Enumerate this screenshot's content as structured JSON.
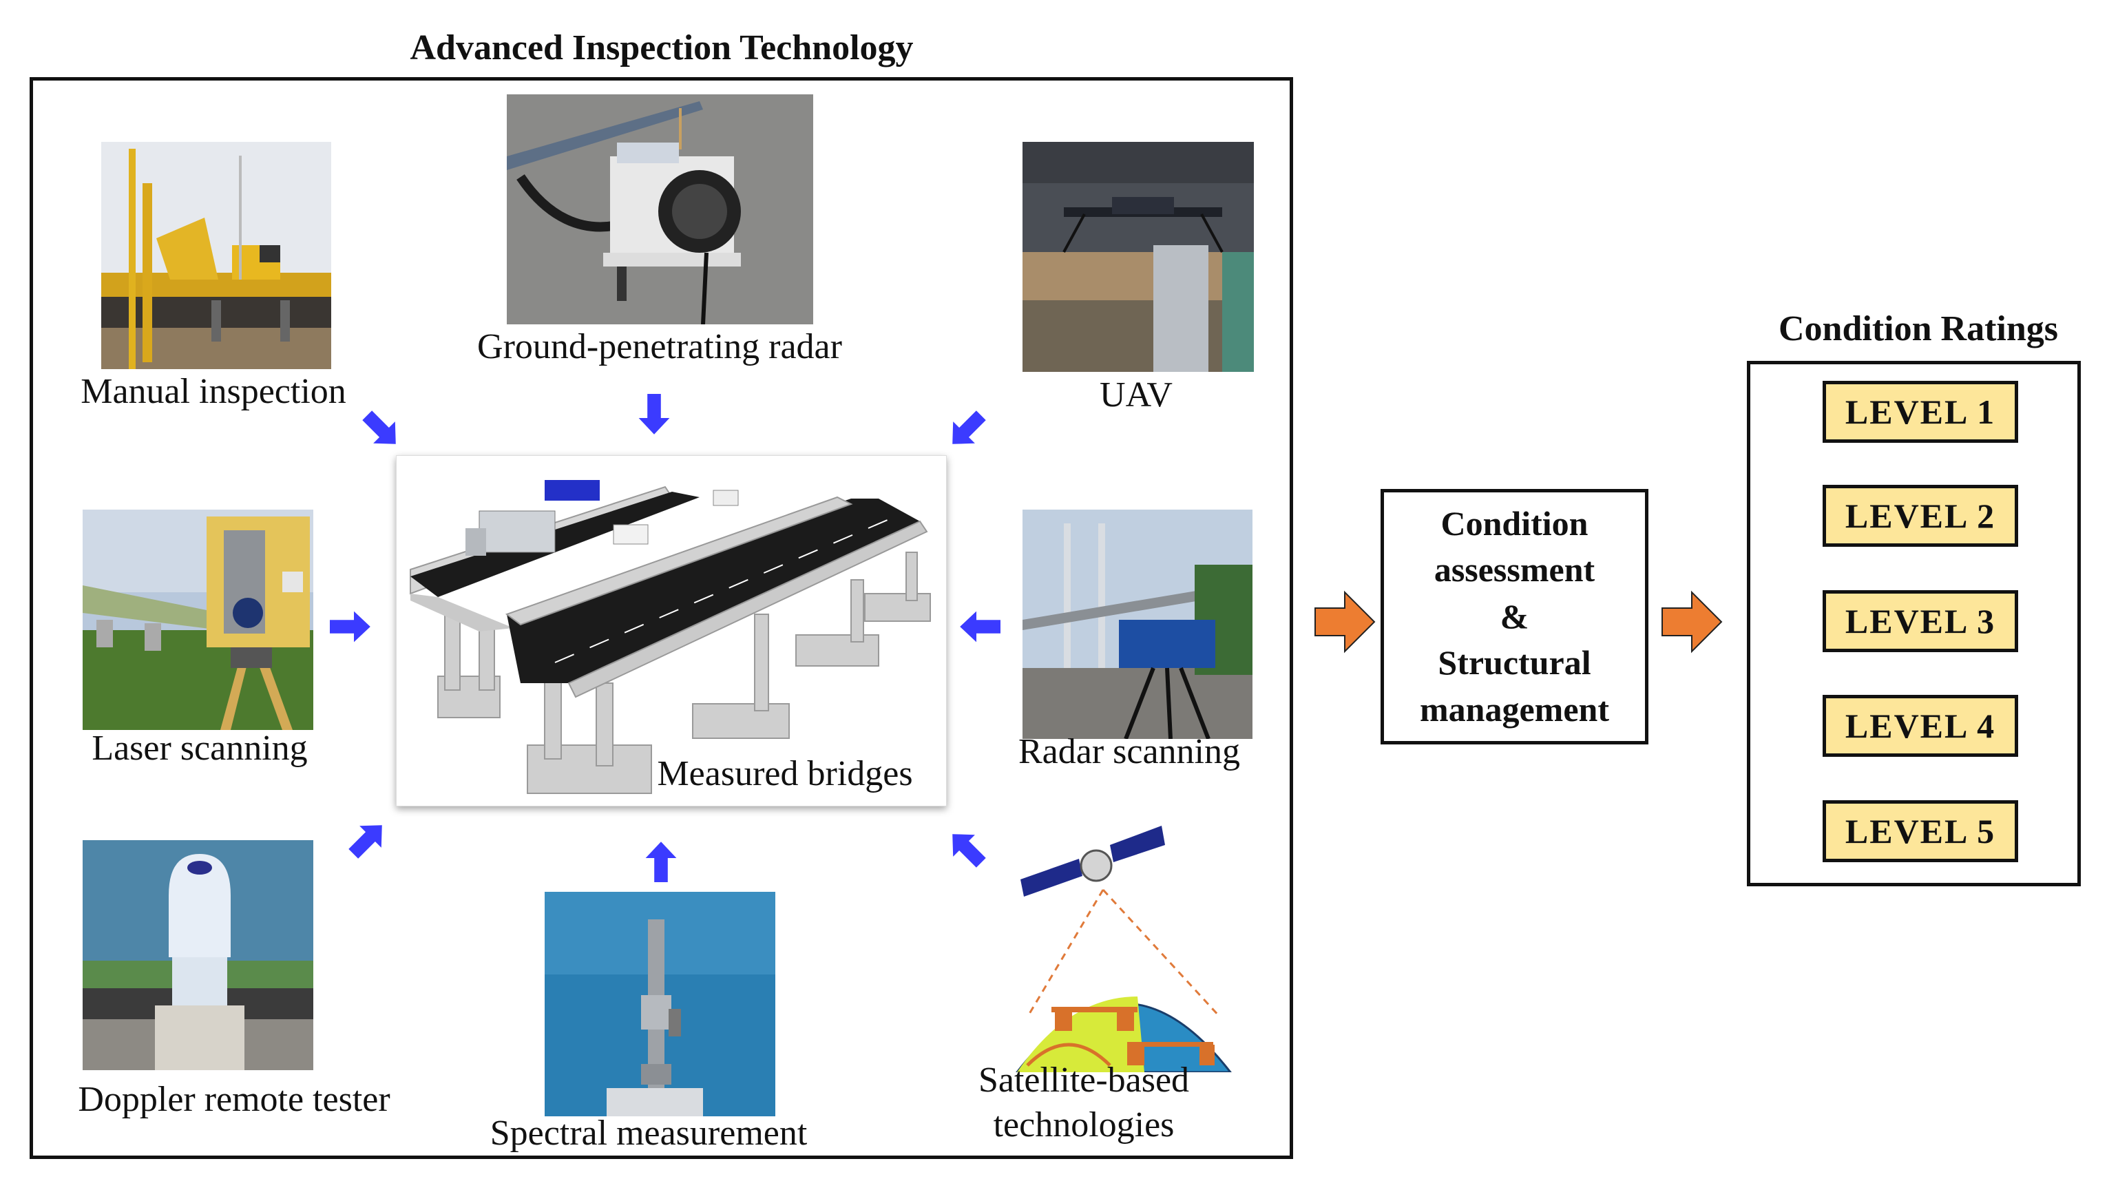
{
  "inspection": {
    "title": "Advanced Inspection Technology",
    "methods": [
      {
        "id": "manual",
        "label": "Manual inspection"
      },
      {
        "id": "gpr",
        "label": "Ground-penetrating radar"
      },
      {
        "id": "uav",
        "label": "UAV"
      },
      {
        "id": "laser",
        "label": "Laser scanning"
      },
      {
        "id": "radar",
        "label": "Radar scanning"
      },
      {
        "id": "doppler",
        "label": "Doppler remote tester"
      },
      {
        "id": "spectral",
        "label": "Spectral measurement"
      },
      {
        "id": "satellite",
        "label_line1": "Satellite-based",
        "label_line2": "technologies"
      }
    ],
    "center": {
      "label": "Measured bridges"
    }
  },
  "assessment": {
    "line1": "Condition",
    "line2": "assessment",
    "line3": "&",
    "line4": "Structural",
    "line5": "management"
  },
  "ratings": {
    "title": "Condition Ratings",
    "levels": [
      "LEVEL 1",
      "LEVEL 2",
      "LEVEL 3",
      "LEVEL 4",
      "LEVEL 5"
    ]
  },
  "colors": {
    "inflow_arrow": "#3b3bff",
    "flow_arrow": "#ed7d31",
    "level_fill": "#fde69a",
    "border": "#111111"
  },
  "icons": {
    "inflow": "blue-block-arrow",
    "flow": "orange-block-arrow"
  }
}
